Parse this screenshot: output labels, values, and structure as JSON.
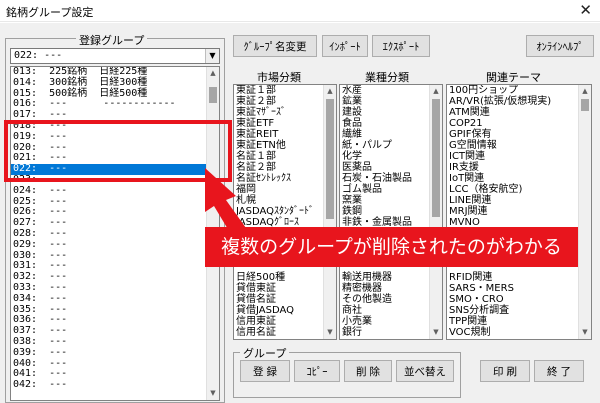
{
  "window": {
    "title": "銘柄グループ設定",
    "close_glyph": "✕"
  },
  "group_frame": {
    "legend": "登録グループ",
    "combo_value": "022: ---",
    "items": [
      "013:  225銘柄  日経225種",
      "014:  300銘柄  日経300種",
      "015:  500銘柄  日経500種",
      "016:  ---      ------------",
      "017:  ---",
      "018:  ---",
      "019:  ---",
      "020:  ---",
      "021:  ---",
      "022:  ---",
      "023:  ---",
      "024:  ---",
      "025:  ---",
      "026:  ---",
      "027:  ---",
      "028:  ---",
      "029:  ---",
      "030:  ---",
      "031:  ---",
      "032:  ---",
      "033:  ---",
      "034:  ---",
      "035:  ---",
      "036:  ---",
      "037:  ---",
      "038:  ---",
      "039:  ---",
      "040:  ---",
      "041:  ---",
      "042:  ---"
    ],
    "selected_index": 9
  },
  "toolbar": {
    "rename": "ｸﾞﾙｰﾌﾟ名変更",
    "import": "ｲﾝﾎﾟｰﾄ",
    "export": "ｴｸｽﾎﾟｰﾄ",
    "help": "ｵﾝﾗｲﾝﾍﾙﾌﾟ"
  },
  "market_frame": {
    "legend": "市場分類",
    "items": [
      "東証１部",
      "東証２部",
      "東証ﾏｻﾞｰｽﾞ",
      "東証ETF",
      "東証REIT",
      "東証ETN他",
      "名証１部",
      "名証２部",
      "名証ｾﾝﾄﾚｯｸｽ",
      "福岡",
      "札幌",
      "JASDAQｽﾀﾝﾀﾞｰﾄﾞ",
      "JASDAQｸﾞﾛｰｽ",
      "",
      "",
      "",
      "",
      "日経500種",
      "貸借東証",
      "貸借名証",
      "貸借JASDAQ",
      "信用東証",
      "信用名証"
    ]
  },
  "industry_frame": {
    "legend": "業種分類",
    "items": [
      "水産",
      "鉱業",
      "建設",
      "食品",
      "繊維",
      "紙・パルプ",
      "化学",
      "医薬品",
      "石炭・石油製品",
      "ゴム製品",
      "窯業",
      "鉄鋼",
      "非鉄・金属製品",
      "",
      "",
      "",
      "",
      "輸送用機器",
      "精密機器",
      "その他製造",
      "商社",
      "小売業",
      "銀行"
    ]
  },
  "theme_frame": {
    "legend": "関連テーマ",
    "items": [
      "100円ショップ",
      "AR/VR(拡張/仮想現実)",
      "ATM関連",
      "COP21",
      "GPIF保有",
      "G空間情報",
      "ICT関連",
      "IR支援",
      "IoT関連",
      "LCC（格安航空)",
      "LINE関連",
      "MRJ関連",
      "MVNO",
      "",
      "",
      "",
      "",
      "RFID関連",
      "SARS・MERS",
      "SMO・CRO",
      "SNS分析調査",
      "TPP関連",
      "VOC規制"
    ]
  },
  "bottom_group": {
    "legend": "グループ",
    "register": "登 録",
    "copy": "ｺﾋﾟｰ",
    "delete": "削 除",
    "sort": "並べ替え"
  },
  "bottom_buttons": {
    "print": "印 刷",
    "close": "終 了"
  },
  "annotation": {
    "callout": "複数のグループが削除されたのがわかる",
    "color": "#e8151d"
  },
  "colors": {
    "selection": "#0078d7",
    "face": "#f0f0f0"
  }
}
